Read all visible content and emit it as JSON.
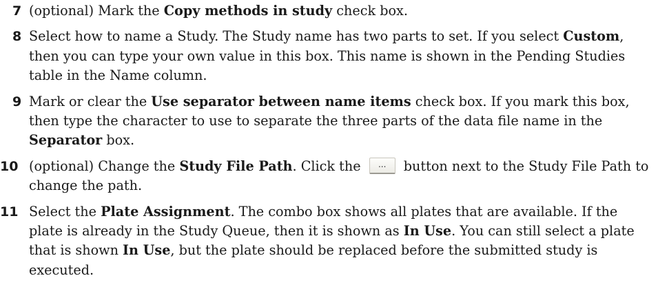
{
  "steps": [
    {
      "num": "7",
      "p1": "(optional) Mark the ",
      "b1": "Copy methods in study",
      "p2": " check box."
    },
    {
      "num": "8",
      "p1": "Select how to name a Study. The Study name has two parts to set. If you select ",
      "b1": "Custom",
      "p2": ", then you can type your own value in this box. This name is shown in the Pending Studies table in the Name column."
    },
    {
      "num": "9",
      "p1": "Mark or clear the ",
      "b1": "Use separator between name items",
      "p2": " check box. If you mark this box, then type the character to use to separate the three parts of the data file name in the ",
      "b2": "Separator",
      "p3": " box."
    },
    {
      "num": "10",
      "p1": "(optional) Change the ",
      "b1": "Study File Path",
      "p2": ". Click the ",
      "button_label": "...",
      "p3": " button next to the Study File Path to change the path."
    },
    {
      "num": "11",
      "p1": "Select the ",
      "b1": "Plate Assignment",
      "p2": ". The combo box shows all plates that are available. If the plate is already in the Study Queue, then it is shown as ",
      "b2": "In Use",
      "p3": ". You can still select a plate that is shown ",
      "b3": "In Use",
      "p4": ", but the plate should be replaced before the submitted study is executed."
    }
  ]
}
